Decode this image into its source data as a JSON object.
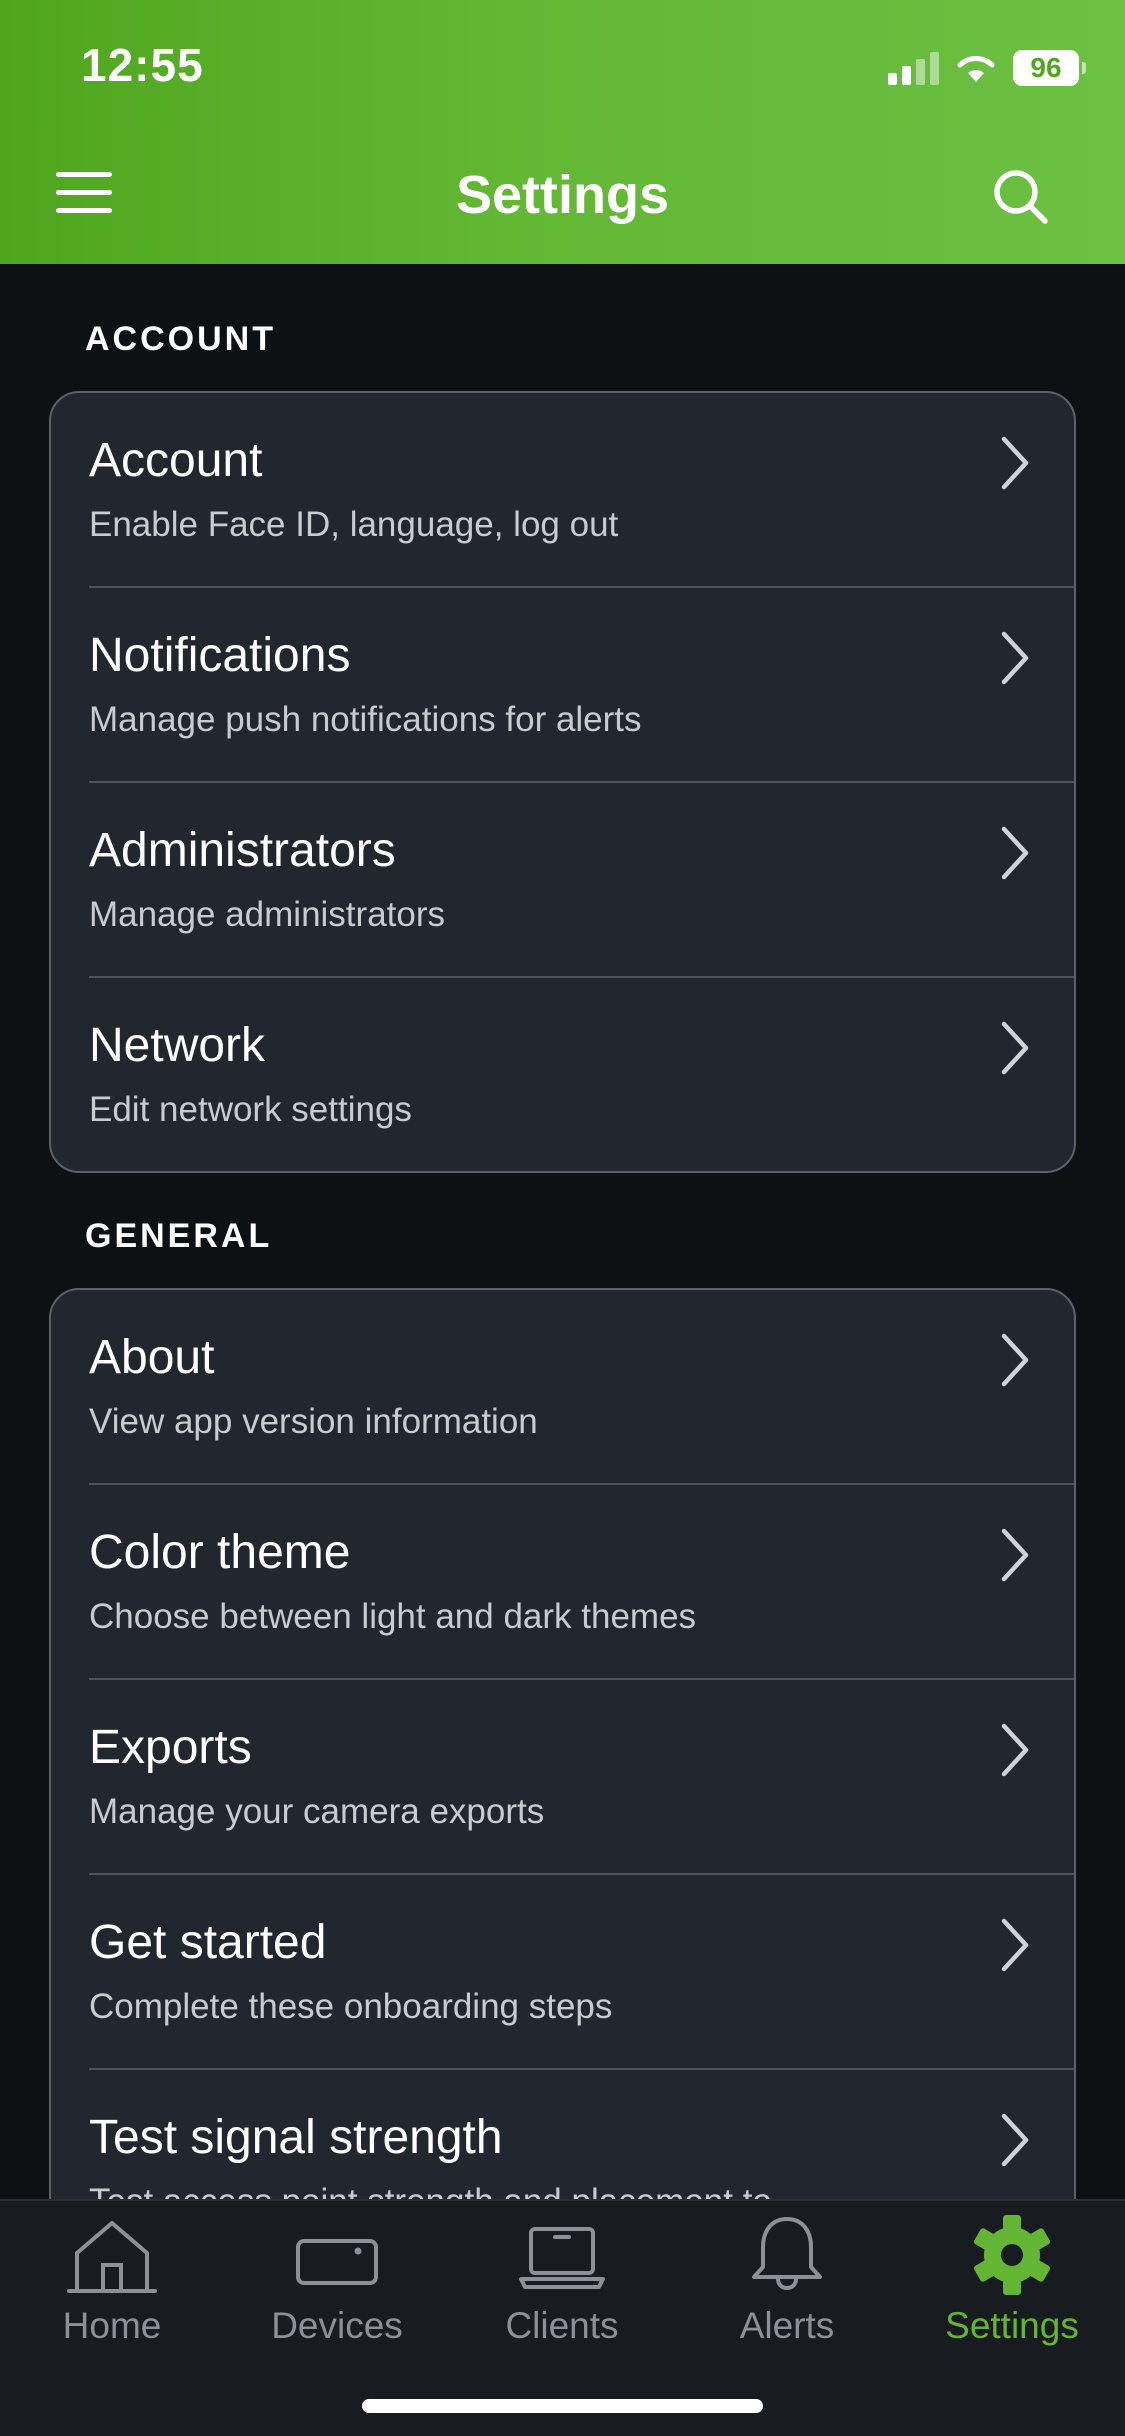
{
  "status_bar": {
    "time": "12:55",
    "battery": "96"
  },
  "header": {
    "title": "Settings",
    "menu_icon": "hamburger-menu-icon",
    "search_icon": "search-icon",
    "background_color": "#62b733"
  },
  "sections": [
    {
      "label": "ACCOUNT",
      "items": [
        {
          "title": "Account",
          "subtitle": "Enable Face ID, language, log out"
        },
        {
          "title": "Notifications",
          "subtitle": "Manage push notifications for alerts"
        },
        {
          "title": "Administrators",
          "subtitle": "Manage administrators"
        },
        {
          "title": "Network",
          "subtitle": "Edit network settings"
        }
      ]
    },
    {
      "label": "GENERAL",
      "items": [
        {
          "title": "About",
          "subtitle": "View app version information"
        },
        {
          "title": "Color theme",
          "subtitle": "Choose between light and dark themes"
        },
        {
          "title": "Exports",
          "subtitle": "Manage your camera exports"
        },
        {
          "title": "Get started",
          "subtitle": "Complete these onboarding steps"
        },
        {
          "title": "Test signal strength",
          "subtitle": "Test access point strength and placement to"
        }
      ]
    }
  ],
  "tabbar": {
    "tabs": [
      {
        "label": "Home",
        "icon": "home-icon"
      },
      {
        "label": "Devices",
        "icon": "device-icon"
      },
      {
        "label": "Clients",
        "icon": "laptop-icon"
      },
      {
        "label": "Alerts",
        "icon": "bell-icon"
      },
      {
        "label": "Settings",
        "icon": "gear-icon"
      }
    ],
    "active_tab": "Settings",
    "active_color": "#63b534",
    "inactive_color": "#8d9096"
  },
  "colors": {
    "background": "#0e1114",
    "card": "#22262e",
    "accent": "#62b733"
  }
}
